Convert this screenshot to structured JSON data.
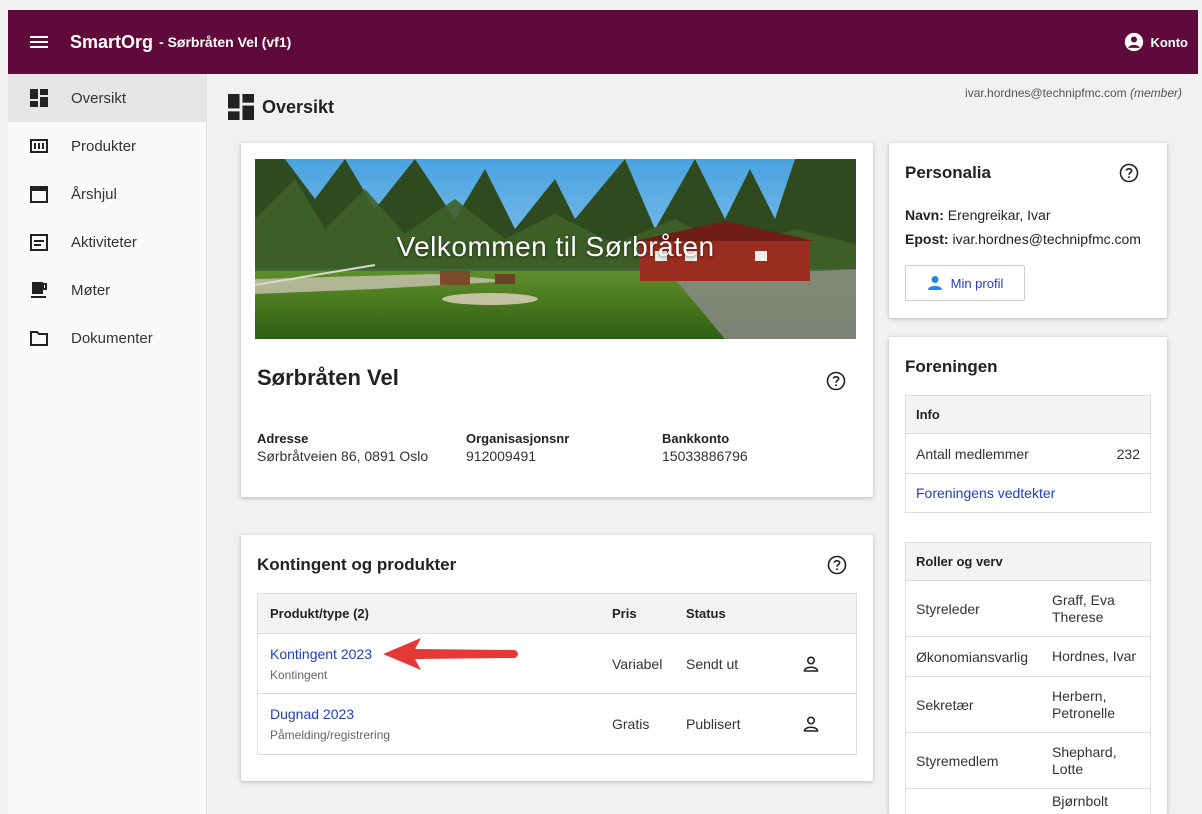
{
  "app": {
    "name": "SmartOrg",
    "org_label": "- Sørbråten Vel (vf1)",
    "account_label": "Konto"
  },
  "sidebar": {
    "items": [
      {
        "label": "Oversikt",
        "icon": "dashboard-icon"
      },
      {
        "label": "Produkter",
        "icon": "counter-icon"
      },
      {
        "label": "Årshjul",
        "icon": "calendar-icon"
      },
      {
        "label": "Aktiviteter",
        "icon": "event-note-icon"
      },
      {
        "label": "Møter",
        "icon": "coffee-icon"
      },
      {
        "label": "Dokumenter",
        "icon": "folder-icon"
      }
    ]
  },
  "page": {
    "title": "Oversikt",
    "user_email": "ivar.hordnes@technipfmc.com",
    "user_role": "(member)"
  },
  "welcome": {
    "banner_text": "Velkommen til Sørbråten",
    "org_name": "Sørbråten Vel",
    "address_label": "Adresse",
    "address_value": "Sørbråtveien 86, 0891 Oslo",
    "orgnr_label": "Organisasjonsnr",
    "orgnr_value": "912009491",
    "bank_label": "Bankkonto",
    "bank_value": "15033886796"
  },
  "products": {
    "title": "Kontingent og produkter",
    "headers": {
      "product": "Produkt/type (2)",
      "price": "Pris",
      "status": "Status"
    },
    "rows": [
      {
        "name": "Kontingent 2023",
        "type": "Kontingent",
        "price": "Variabel",
        "status": "Sendt ut"
      },
      {
        "name": "Dugnad 2023",
        "type": "Påmelding/registrering",
        "price": "Gratis",
        "status": "Publisert"
      }
    ]
  },
  "personalia": {
    "title": "Personalia",
    "name_label": "Navn:",
    "name_value": "Erengreikar, Ivar",
    "email_label": "Epost:",
    "email_value": "ivar.hordnes@technipfmc.com",
    "profile_button": "Min profil"
  },
  "foreningen": {
    "title": "Foreningen",
    "info_header": "Info",
    "members_label": "Antall medlemmer",
    "members_value": "232",
    "statutes_link": "Foreningens vedtekter",
    "roles_header": "Roller og verv",
    "roles": [
      {
        "role": "Styreleder",
        "name": "Graff, Eva Therese"
      },
      {
        "role": "Økonomiansvarlig",
        "name": "Hordnes, Ivar"
      },
      {
        "role": "Sekretær",
        "name": "Herbern, Petronelle"
      },
      {
        "role": "Styremedlem",
        "name": "Shephard, Lotte"
      },
      {
        "role": "",
        "name": "Bjørnbolt"
      }
    ]
  },
  "colors": {
    "topbar": "#5f0a3a",
    "link": "#2040c0",
    "arrow": "#e53935"
  }
}
